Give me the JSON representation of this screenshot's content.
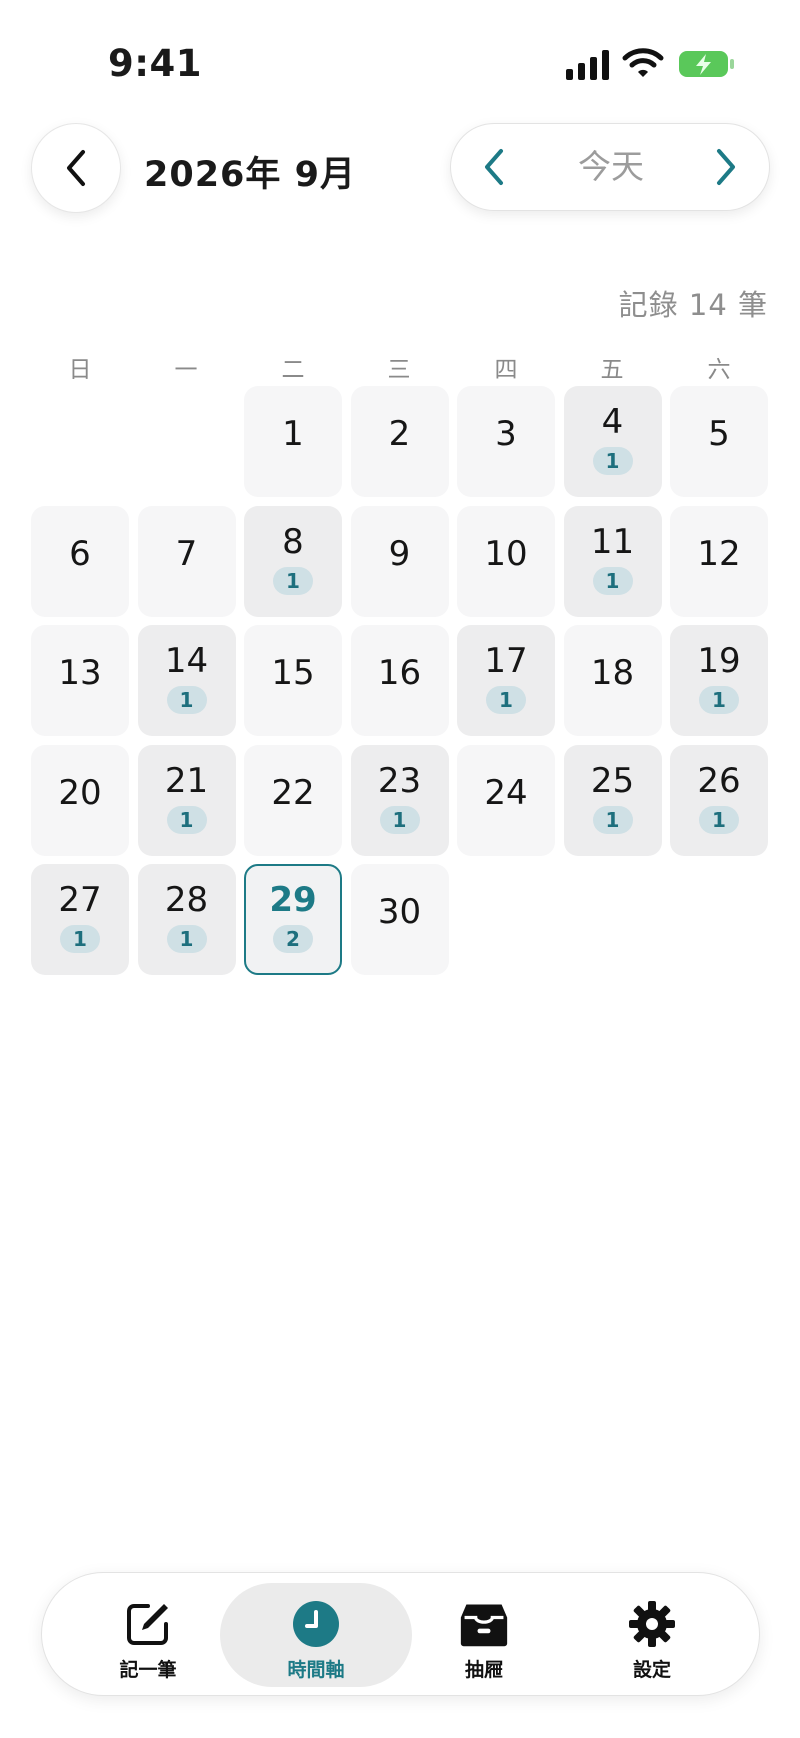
{
  "status_bar": {
    "time": "9:41",
    "signal_icon": "cellular-signal-icon",
    "wifi_icon": "wifi-icon",
    "battery_icon": "battery-charging-icon"
  },
  "header": {
    "back_icon": "chevron-left-icon",
    "title": "2026年 9月",
    "nav": {
      "prev_icon": "chevron-left-icon",
      "today_label": "今天",
      "next_icon": "chevron-right-icon"
    }
  },
  "record_count": "記錄 14 筆",
  "calendar": {
    "weekdays": [
      "日",
      "一",
      "二",
      "三",
      "四",
      "五",
      "六"
    ],
    "first_weekday_index": 2,
    "days": [
      {
        "day": "1",
        "count": null
      },
      {
        "day": "2",
        "count": null
      },
      {
        "day": "3",
        "count": null
      },
      {
        "day": "4",
        "count": "1"
      },
      {
        "day": "5",
        "count": null
      },
      {
        "day": "6",
        "count": null
      },
      {
        "day": "7",
        "count": null
      },
      {
        "day": "8",
        "count": "1"
      },
      {
        "day": "9",
        "count": null
      },
      {
        "day": "10",
        "count": null
      },
      {
        "day": "11",
        "count": "1"
      },
      {
        "day": "12",
        "count": null
      },
      {
        "day": "13",
        "count": null
      },
      {
        "day": "14",
        "count": "1"
      },
      {
        "day": "15",
        "count": null
      },
      {
        "day": "16",
        "count": null
      },
      {
        "day": "17",
        "count": "1"
      },
      {
        "day": "18",
        "count": null
      },
      {
        "day": "19",
        "count": "1"
      },
      {
        "day": "20",
        "count": null
      },
      {
        "day": "21",
        "count": "1"
      },
      {
        "day": "22",
        "count": null
      },
      {
        "day": "23",
        "count": "1"
      },
      {
        "day": "24",
        "count": null
      },
      {
        "day": "25",
        "count": "1"
      },
      {
        "day": "26",
        "count": "1"
      },
      {
        "day": "27",
        "count": "1"
      },
      {
        "day": "28",
        "count": "1"
      },
      {
        "day": "29",
        "count": "2",
        "today": true
      },
      {
        "day": "30",
        "count": null
      }
    ]
  },
  "tab_bar": {
    "tabs": [
      {
        "label": "記一筆",
        "icon": "compose-icon",
        "active": false
      },
      {
        "label": "時間軸",
        "icon": "clock-icon",
        "active": true
      },
      {
        "label": "抽屜",
        "icon": "drawer-icon",
        "active": false
      },
      {
        "label": "設定",
        "icon": "gear-icon",
        "active": false
      }
    ]
  },
  "colors": {
    "accent": "#1d7a86",
    "badge_bg": "#cfe0e5",
    "battery_green": "#5ac85a"
  }
}
